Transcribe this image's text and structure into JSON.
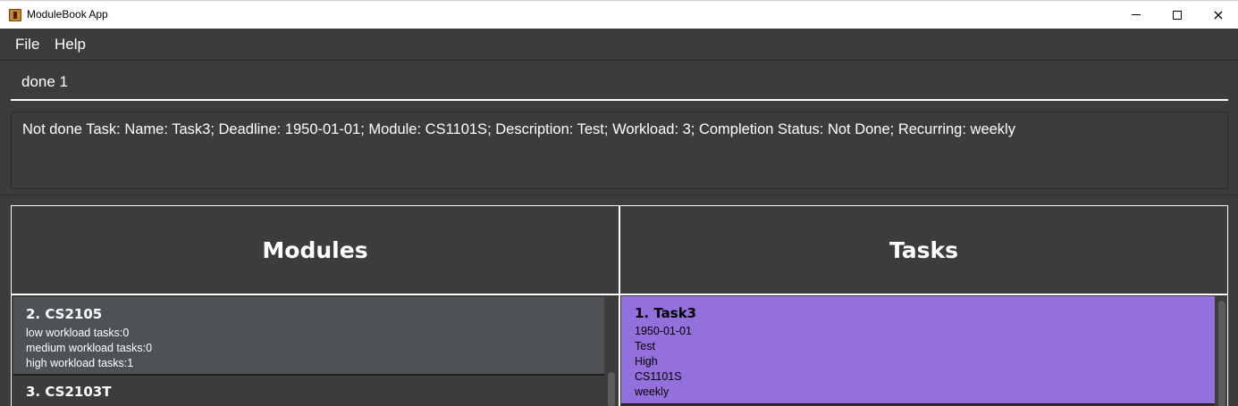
{
  "window": {
    "title": "ModuleBook App",
    "icon": "java-app-icon",
    "controls": {
      "minimize": "minimize-icon",
      "maximize": "maximize-icon",
      "close": "×"
    }
  },
  "menu": {
    "file": "File",
    "help": "Help"
  },
  "command_box": {
    "value": "done 1"
  },
  "result_display": {
    "text": "Not done Task: Name: Task3; Deadline: 1950-01-01; Module: CS1101S; Description: Test; Workload: 3; Completion Status: Not Done; Recurring: weekly"
  },
  "modules_panel": {
    "title": "Modules",
    "items": [
      {
        "title": "2.  CS2105",
        "lines": [
          "low workload tasks:0",
          "medium workload tasks:0",
          "high workload tasks:1"
        ],
        "background": "#4d5256"
      },
      {
        "title": "3.  CS2103T",
        "lines": []
      }
    ]
  },
  "tasks_panel": {
    "title": "Tasks",
    "items": [
      {
        "title": "1.  Task3",
        "lines": [
          "1950-01-01",
          "Test",
          "High",
          "CS1101S",
          "weekly"
        ],
        "background": "#9370db"
      }
    ]
  },
  "colors": {
    "background": "#3c3c3c",
    "text": "#ffffff",
    "task_card": "#9370db",
    "module_card_selected": "#4d5256"
  }
}
